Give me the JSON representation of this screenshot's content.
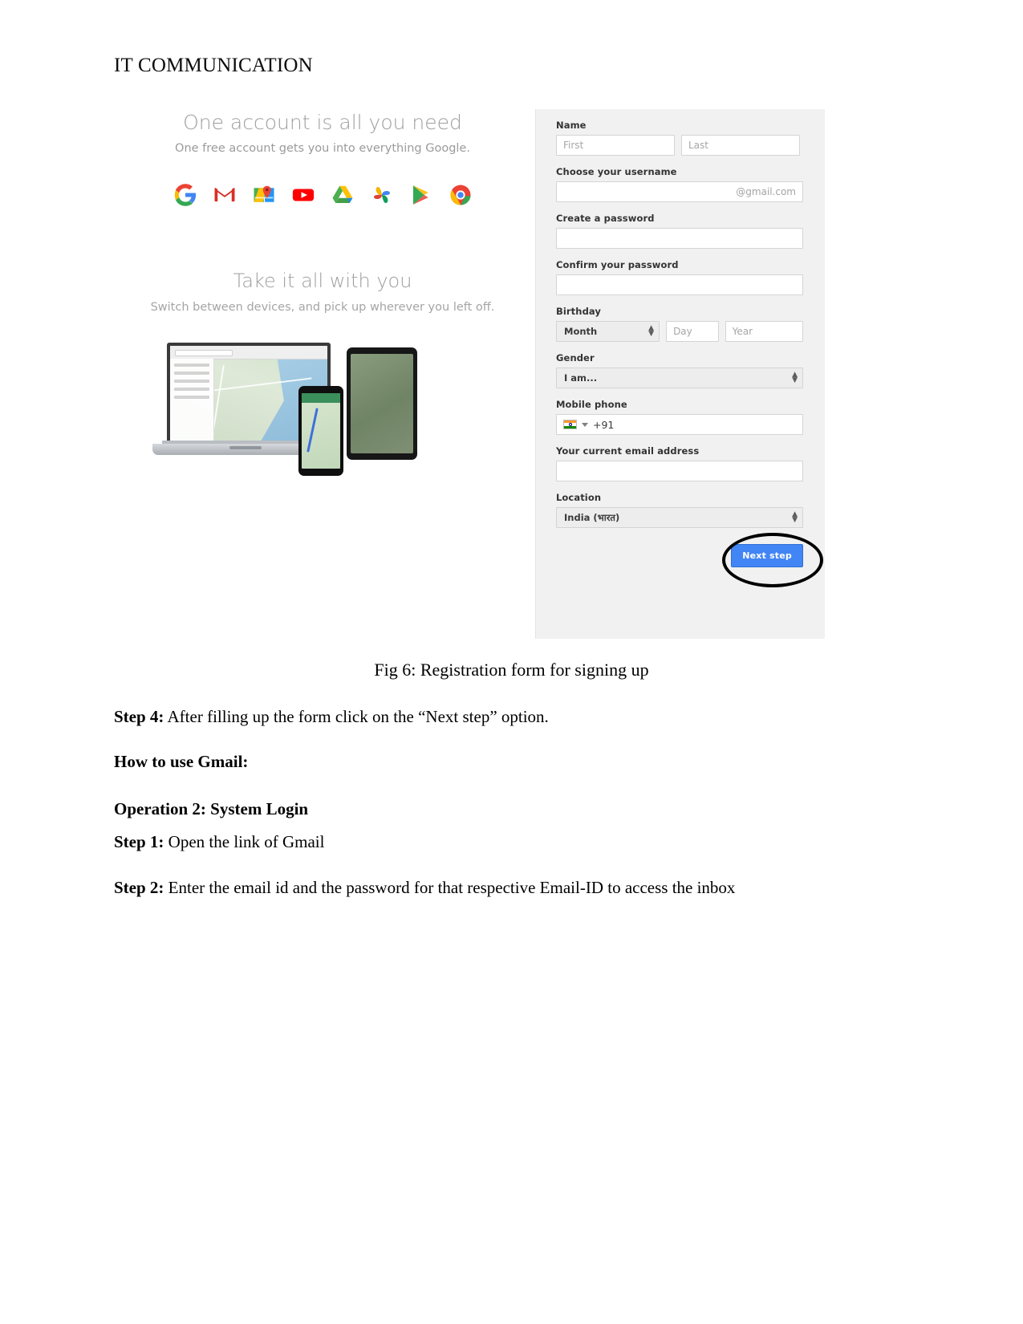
{
  "document": {
    "header": "IT COMMUNICATION",
    "caption": "Fig 6: Registration form for signing up",
    "paragraphs": [
      {
        "label": "Step 4:",
        "text": " After filling up the form click on the “Next step” option."
      },
      {
        "label": "How to use Gmail:",
        "text": ""
      },
      {
        "label": "Operation 2: System Login",
        "text": ""
      },
      {
        "label": "Step 1:",
        "text": " Open the link of Gmail"
      },
      {
        "label": "Step 2:",
        "text": " Enter the email id and the password for that respective Email-ID to access the inbox"
      }
    ]
  },
  "promo": {
    "title_1": "One account is all you need",
    "subtitle_1": "One free account gets you into everything Google.",
    "title_2": "Take it all with you",
    "subtitle_2": "Switch between devices, and pick up wherever you left off.",
    "icons": [
      {
        "name": "google-icon",
        "label": "Google"
      },
      {
        "name": "gmail-icon",
        "label": "Gmail"
      },
      {
        "name": "maps-icon",
        "label": "Maps"
      },
      {
        "name": "youtube-icon",
        "label": "YouTube"
      },
      {
        "name": "drive-icon",
        "label": "Drive"
      },
      {
        "name": "photos-icon",
        "label": "Photos"
      },
      {
        "name": "play-icon",
        "label": "Play"
      },
      {
        "name": "chrome-icon",
        "label": "Chrome"
      }
    ]
  },
  "form": {
    "name": {
      "label": "Name",
      "first_placeholder": "First",
      "first_value": "",
      "last_placeholder": "Last",
      "last_value": ""
    },
    "username": {
      "label": "Choose your username",
      "value": "",
      "suffix": "@gmail.com"
    },
    "password": {
      "label": "Create a password",
      "value": ""
    },
    "confirm_password": {
      "label": "Confirm your password",
      "value": ""
    },
    "birthday": {
      "label": "Birthday",
      "month_selected": "Month",
      "day_placeholder": "Day",
      "day_value": "",
      "year_placeholder": "Year",
      "year_value": ""
    },
    "gender": {
      "label": "Gender",
      "selected": "I am..."
    },
    "mobile": {
      "label": "Mobile phone",
      "country_code": "+91",
      "flag": "india-flag-icon",
      "value": ""
    },
    "current_email": {
      "label": "Your current email address",
      "value": ""
    },
    "location": {
      "label": "Location",
      "selected": "India (भारत)"
    },
    "next_button": "Next step"
  },
  "colors": {
    "button_blue": "#4285f4",
    "panel_background": "#f1f1f1",
    "annotation": "#000000"
  }
}
